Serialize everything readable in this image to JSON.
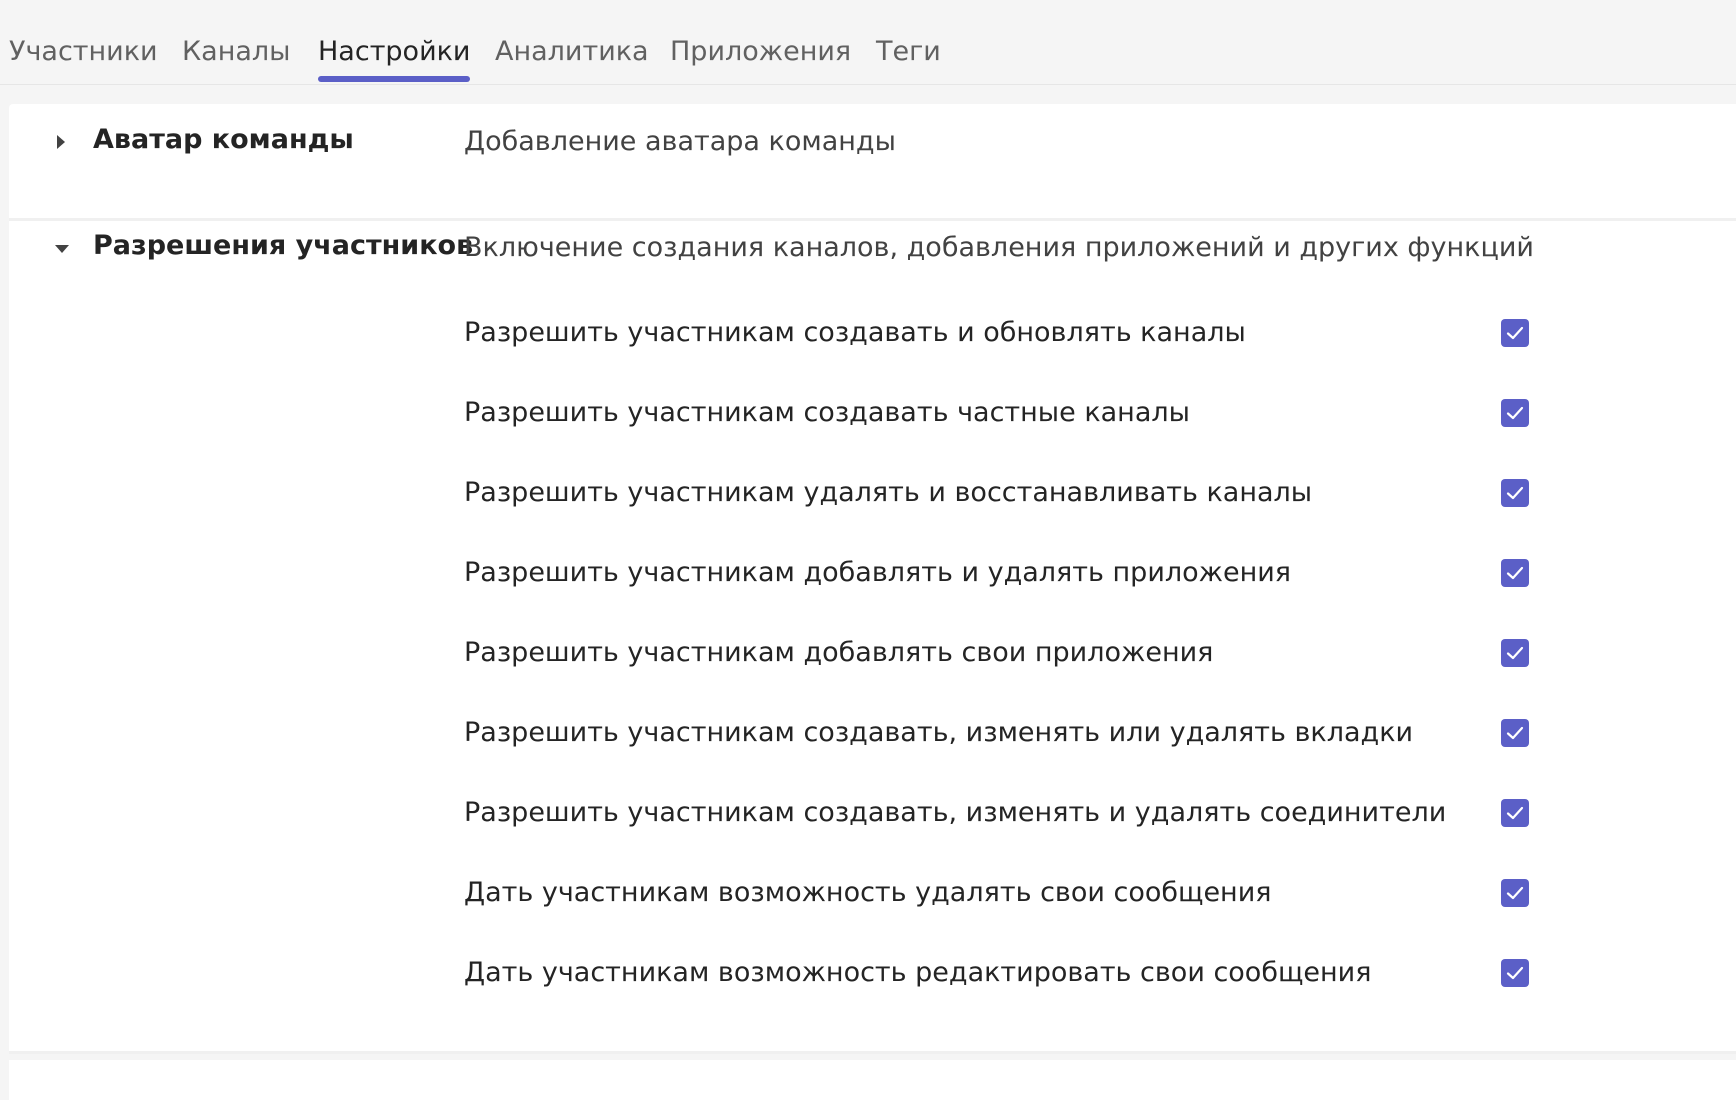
{
  "tabs": [
    {
      "label": "Участники"
    },
    {
      "label": "Каналы"
    },
    {
      "label": "Настройки"
    },
    {
      "label": "Аналитика"
    },
    {
      "label": "Приложения"
    },
    {
      "label": "Теги"
    }
  ],
  "sections": {
    "avatar": {
      "title": "Аватар команды",
      "description": "Добавление аватара команды",
      "expanded": false
    },
    "permissions": {
      "title": "Разрешения участников",
      "description": "Включение создания каналов, добавления приложений и других функций",
      "expanded": true,
      "items": [
        {
          "label": "Разрешить участникам создавать и обновлять каналы",
          "checked": true
        },
        {
          "label": "Разрешить участникам создавать частные каналы",
          "checked": true
        },
        {
          "label": "Разрешить участникам удалять и восстанавливать каналы",
          "checked": true
        },
        {
          "label": "Разрешить участникам добавлять и удалять приложения",
          "checked": true
        },
        {
          "label": "Разрешить участникам добавлять свои приложения",
          "checked": true
        },
        {
          "label": "Разрешить участникам создавать, изменять или удалять вкладки",
          "checked": true
        },
        {
          "label": "Разрешить участникам создавать, изменять и удалять соединители",
          "checked": true
        },
        {
          "label": "Дать участникам возможность удалять свои сообщения",
          "checked": true
        },
        {
          "label": "Дать участникам возможность редактировать свои сообщения",
          "checked": true
        }
      ]
    }
  },
  "icons": {
    "collapsed": "chevron-right-icon",
    "expanded": "chevron-down-icon",
    "check": "checkmark-icon"
  },
  "colors": {
    "accent": "#5b5fc7",
    "page_background": "#f5f5f5",
    "card_background": "#ffffff"
  }
}
